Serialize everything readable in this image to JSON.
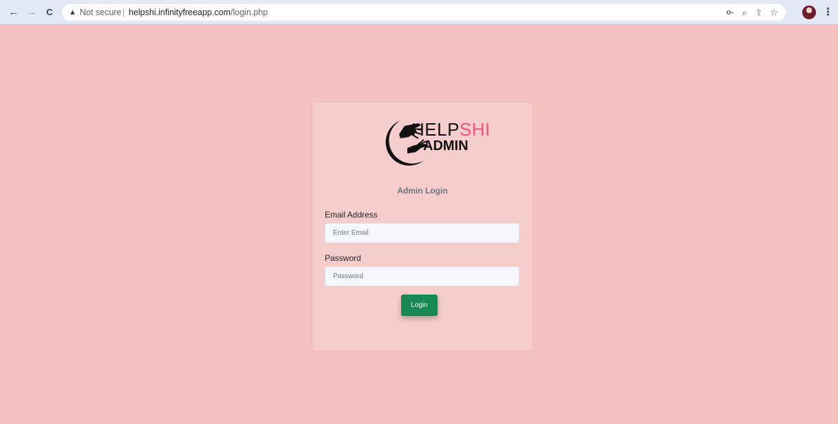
{
  "browser": {
    "back_icon": "←",
    "forward_icon": "→",
    "reload_icon": "C",
    "warning_icon": "▲",
    "security_label": "Not secure",
    "separator": "|",
    "url_host": "helpshi.infinityfreeapp.com",
    "url_path": "/login.php",
    "key_icon": "o-",
    "zoom_icon": "⌕",
    "share_icon": "⇪",
    "star_icon": "☆",
    "menu_icon": "⋮"
  },
  "logo": {
    "text_black": "HELP",
    "text_pink": "SHI",
    "subtitle": "ADMIN",
    "colors": {
      "black": "#111111",
      "pink": "#e8567a"
    }
  },
  "login": {
    "title": "Admin Login",
    "email_label": "Email Address",
    "email_placeholder": "Enter Email",
    "email_value": "",
    "password_label": "Password",
    "password_placeholder": "Password",
    "password_value": "",
    "button_label": "Login"
  },
  "colors": {
    "page_background": "#f4c2c2",
    "card_background": "#f7cccc",
    "button": "#198754"
  }
}
